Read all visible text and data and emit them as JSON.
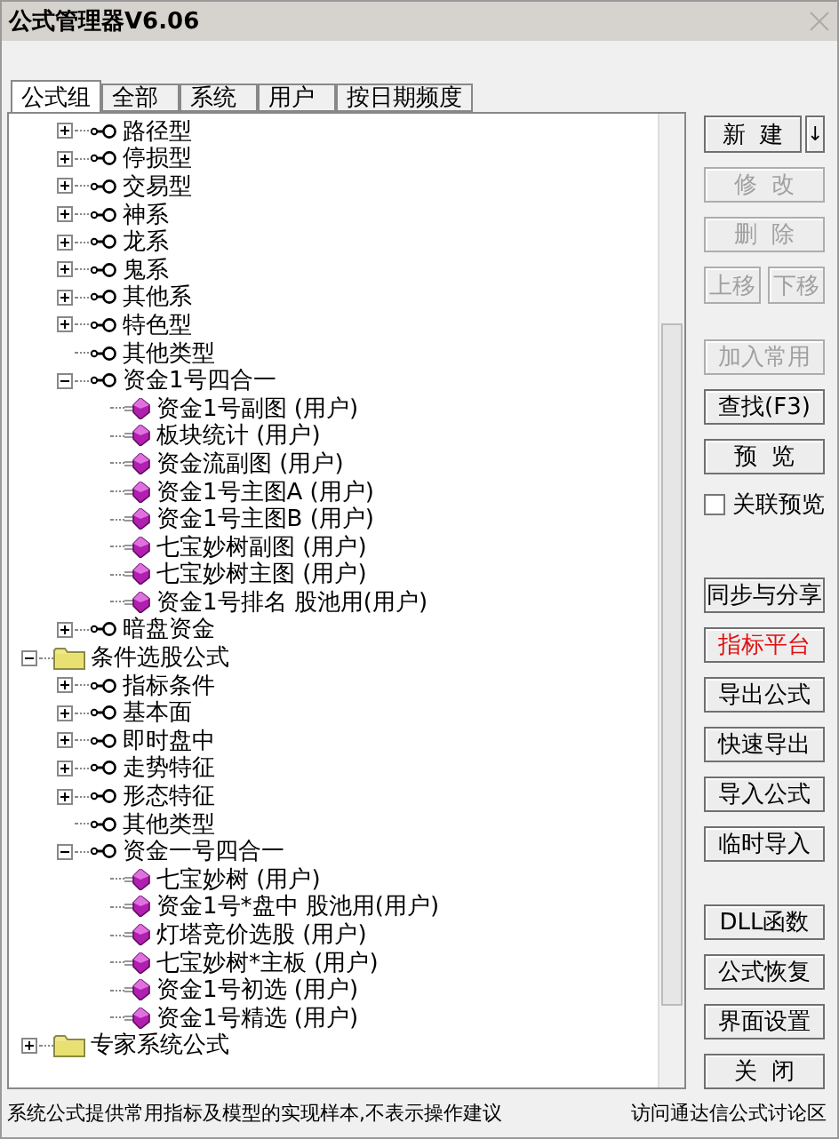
{
  "window": {
    "title": "公式管理器V6.06"
  },
  "tabs": [
    {
      "label": "公式组",
      "selected": true
    },
    {
      "label": "全部",
      "selected": false
    },
    {
      "label": "系统",
      "selected": false
    },
    {
      "label": "用户",
      "selected": false
    },
    {
      "label": "按日期频度",
      "selected": false
    }
  ],
  "tree": [
    {
      "kind": "continued",
      "children": [
        {
          "kind": "category",
          "label": "路径型",
          "expanded": false
        },
        {
          "kind": "category",
          "label": "停损型",
          "expanded": false
        },
        {
          "kind": "category",
          "label": "交易型",
          "expanded": false
        },
        {
          "kind": "category",
          "label": "神系",
          "expanded": false
        },
        {
          "kind": "category",
          "label": "龙系",
          "expanded": false
        },
        {
          "kind": "category",
          "label": "鬼系",
          "expanded": false
        },
        {
          "kind": "category",
          "label": "其他系",
          "expanded": false
        },
        {
          "kind": "category",
          "label": "特色型",
          "expanded": false
        },
        {
          "kind": "category",
          "label": "其他类型"
        },
        {
          "kind": "category",
          "label": "资金1号四合一",
          "expanded": true,
          "children": [
            {
              "kind": "formula",
              "label": "资金1号副图  (用户)"
            },
            {
              "kind": "formula",
              "label": "板块统计  (用户)"
            },
            {
              "kind": "formula",
              "label": "资金流副图  (用户)"
            },
            {
              "kind": "formula",
              "label": "资金1号主图A  (用户)"
            },
            {
              "kind": "formula",
              "label": "资金1号主图B  (用户)"
            },
            {
              "kind": "formula",
              "label": "七宝妙树副图  (用户)"
            },
            {
              "kind": "formula",
              "label": "七宝妙树主图  (用户)"
            },
            {
              "kind": "formula",
              "label": "资金1号排名  股池用(用户)"
            }
          ]
        },
        {
          "kind": "category",
          "label": "暗盘资金",
          "expanded": false
        }
      ]
    },
    {
      "kind": "folder",
      "label": "条件选股公式",
      "expanded": true,
      "children": [
        {
          "kind": "category",
          "label": "指标条件",
          "expanded": false
        },
        {
          "kind": "category",
          "label": "基本面",
          "expanded": false
        },
        {
          "kind": "category",
          "label": "即时盘中",
          "expanded": false
        },
        {
          "kind": "category",
          "label": "走势特征",
          "expanded": false
        },
        {
          "kind": "category",
          "label": "形态特征",
          "expanded": false
        },
        {
          "kind": "category",
          "label": "其他类型"
        },
        {
          "kind": "category",
          "label": "资金一号四合一",
          "expanded": true,
          "children": [
            {
              "kind": "formula",
              "label": "七宝妙树  (用户)"
            },
            {
              "kind": "formula",
              "label": "资金1号*盘中  股池用(用户)"
            },
            {
              "kind": "formula",
              "label": "灯塔竞价选股  (用户)"
            },
            {
              "kind": "formula",
              "label": "七宝妙树*主板  (用户)"
            },
            {
              "kind": "formula",
              "label": "资金1号初选  (用户)"
            },
            {
              "kind": "formula",
              "label": "资金1号精选  (用户)"
            }
          ]
        }
      ]
    },
    {
      "kind": "folder",
      "label": "专家系统公式",
      "expanded": false
    }
  ],
  "new_button": {
    "label": "新  建",
    "arrow": "↓"
  },
  "buttons_top": [
    {
      "label": "修  改",
      "disabled": true
    },
    {
      "label": "删  除",
      "disabled": true
    }
  ],
  "move_buttons": [
    {
      "label": "上移",
      "disabled": true
    },
    {
      "label": "下移",
      "disabled": true
    }
  ],
  "buttons_mid": [
    {
      "label": "加入常用",
      "disabled": true
    },
    {
      "label": "查找(F3)",
      "disabled": false
    },
    {
      "label": "预  览",
      "disabled": false
    }
  ],
  "preview_checkbox": {
    "label": "关联预览",
    "checked": false
  },
  "buttons_tools": [
    {
      "label": "同步与分享",
      "emphasis": false
    },
    {
      "label": "指标平台",
      "emphasis": true
    },
    {
      "label": "导出公式",
      "emphasis": false
    },
    {
      "label": "快速导出",
      "emphasis": false
    },
    {
      "label": "导入公式",
      "emphasis": false
    },
    {
      "label": "临时导入",
      "emphasis": false
    }
  ],
  "buttons_bottom": [
    {
      "label": "DLL函数"
    },
    {
      "label": "公式恢复"
    },
    {
      "label": "界面设置"
    },
    {
      "label": "关  闭"
    }
  ],
  "status_bar": {
    "note": "系统公式提供常用指标及模型的实现样本,不表示操作建议",
    "link": "访问通达信公式讨论区"
  }
}
